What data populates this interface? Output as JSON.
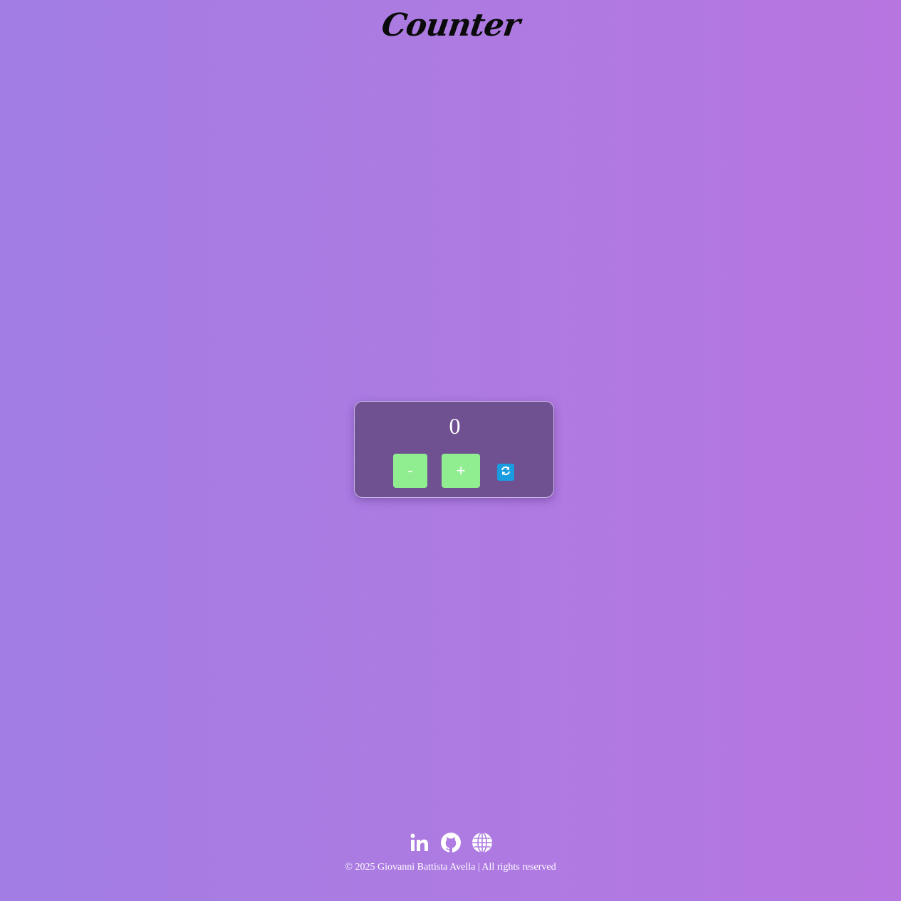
{
  "header": {
    "title": "Counter"
  },
  "counter": {
    "value": "0",
    "decrement_label": "-",
    "increment_label": "+",
    "reset_icon": "refresh-icon"
  },
  "footer": {
    "icons": [
      "linkedin-icon",
      "github-icon",
      "globe-icon"
    ],
    "copyright": "© 2025 Giovanni Battista Avella | All rights reserved"
  },
  "colors": {
    "background_start": "#a17de4",
    "background_end": "#b775e0",
    "card": "#6f5191",
    "button": "#90ee90",
    "reset": "#1a9ce0"
  }
}
